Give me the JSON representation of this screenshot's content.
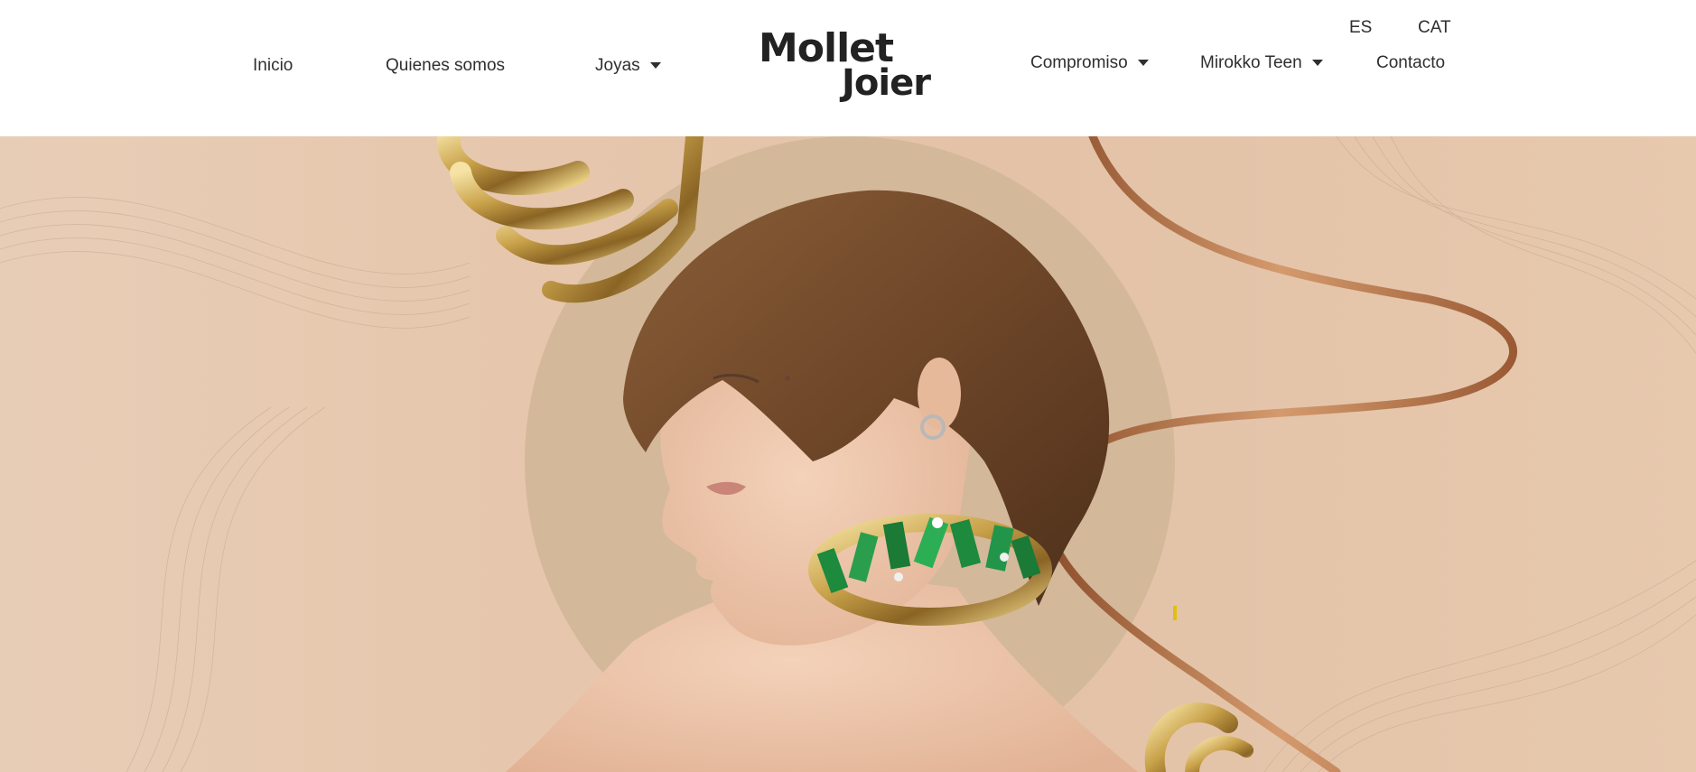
{
  "nav": {
    "left": [
      {
        "label": "Inicio"
      },
      {
        "label": "Quienes somos"
      },
      {
        "label": "Joyas"
      }
    ],
    "right": [
      {
        "label": "Compromiso"
      },
      {
        "label": "Mirokko Teen"
      },
      {
        "label": "Contacto"
      }
    ],
    "languages": [
      "ES",
      "CAT"
    ]
  },
  "logo": {
    "line1": "Mollet",
    "line2": "Joier"
  },
  "colors": {
    "hero_background": "#e6c7ad",
    "circle": "#d4b99a",
    "gold": "#c9a24a",
    "copper_wire": "#b8754a",
    "emerald": "#1d8a3e",
    "hair": "#7a5232",
    "skin": "#efc8ae"
  }
}
